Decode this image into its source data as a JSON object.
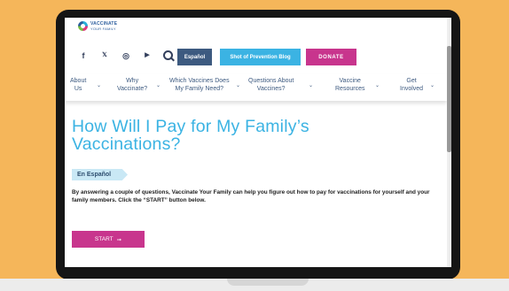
{
  "logo": {
    "line1": "VACCINATE",
    "line2": "YOUR FAMILY"
  },
  "social": [
    {
      "icon": "facebook-icon",
      "glyph": "f"
    },
    {
      "icon": "twitter-icon",
      "glyph": "𝕏"
    },
    {
      "icon": "instagram-icon",
      "glyph": "◎"
    },
    {
      "icon": "youtube-icon",
      "glyph": "▶"
    }
  ],
  "header": {
    "espanol": "Español",
    "blog": "Shot of Prevention Blog",
    "donate": "DONATE"
  },
  "nav": [
    "About\nUs",
    "Why\nVaccinate?",
    "Which Vaccines Does\nMy Family Need?",
    "Questions About\nVaccines?",
    "Vaccine\nResources",
    "Get\nInvolved"
  ],
  "main": {
    "title": "How Will I Pay for My Family’s Vaccinations?",
    "en_espanol": "En Español",
    "intro": "By answering a couple of questions, Vaccinate Your Family can help you figure out how to pay for vaccinations for yourself and your family members. Click the “START” button below.",
    "start": "START",
    "start_arrow": "➞"
  },
  "colors": {
    "background": "#F5B65A",
    "title": "#3BB3E3",
    "donate": "#C8358D",
    "espanol_btn": "#3D5A80",
    "blog_btn": "#3BB3E3"
  }
}
